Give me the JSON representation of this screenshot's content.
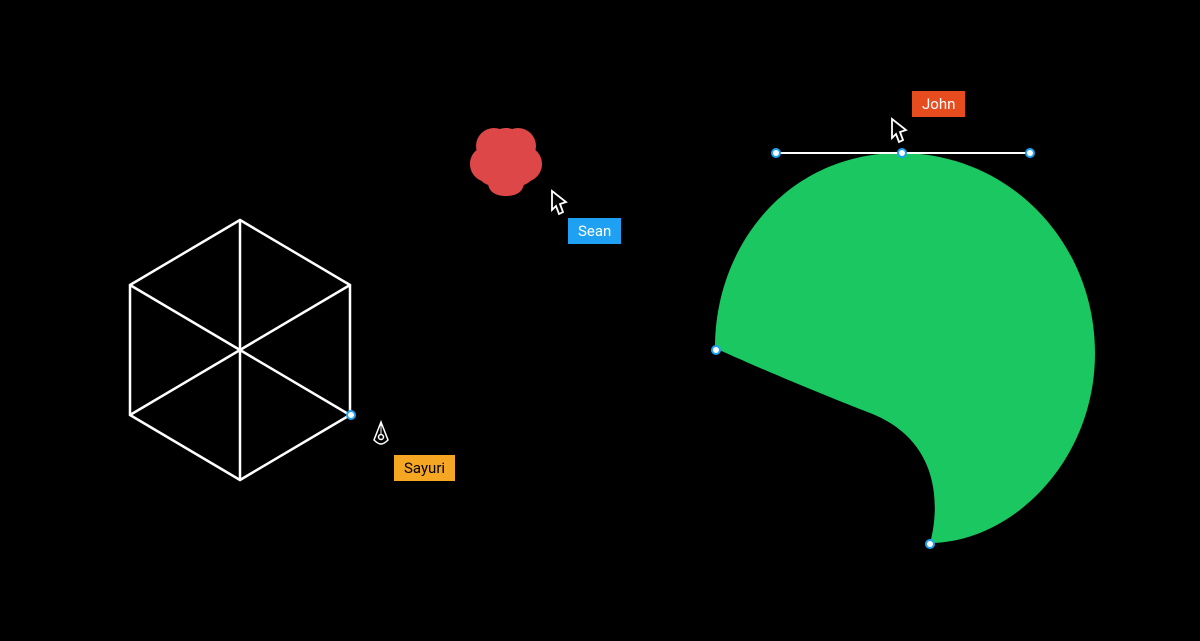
{
  "canvas": {
    "background": "#000000"
  },
  "shapes": {
    "hexagon": {
      "type": "wireframe-cube",
      "stroke": "#FFFFFF"
    },
    "flower": {
      "type": "quatrefoil",
      "fill": "#DD4747"
    },
    "blob": {
      "type": "bezier-shape",
      "fill": "#1BC761"
    }
  },
  "collaborators": {
    "sayuri": {
      "name": "Sayuri",
      "color": "#F5A623",
      "tool": "pen"
    },
    "sean": {
      "name": "Sean",
      "color": "#1EA1F2",
      "tool": "cursor"
    },
    "john": {
      "name": "John",
      "color": "#E74C1E",
      "tool": "cursor"
    }
  },
  "handles": {
    "fill": "#FFFFFF",
    "stroke": "#1EA1F2"
  }
}
